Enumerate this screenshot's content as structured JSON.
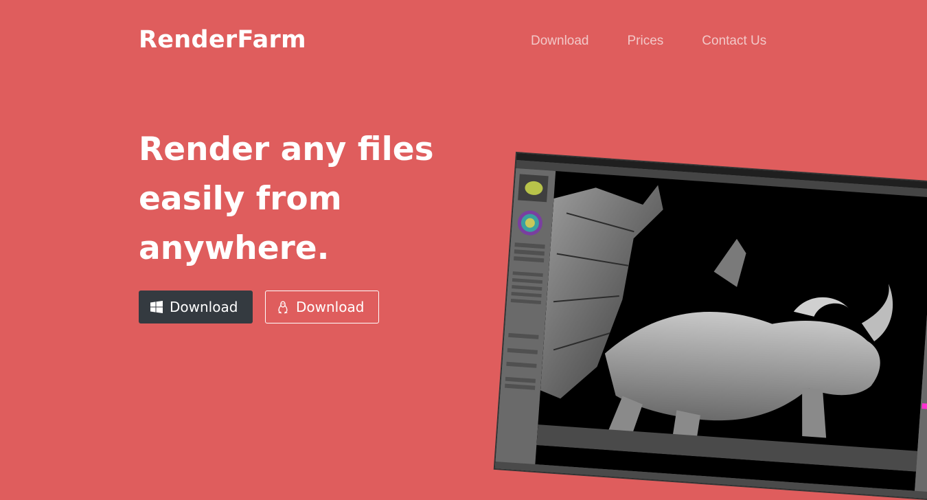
{
  "brand": "RenderFarm",
  "nav": {
    "download": "Download",
    "prices": "Prices",
    "contact": "Contact Us"
  },
  "hero": {
    "line1": "Render any files",
    "line2": "easily from",
    "line3": "anywhere."
  },
  "buttons": {
    "windows_label": "Download",
    "linux_label": "Download"
  },
  "icons": {
    "windows": "windows-icon",
    "linux": "linux-icon"
  },
  "colors": {
    "background": "#df5d5d",
    "dark_button": "#343a40",
    "text": "#ffffff"
  }
}
